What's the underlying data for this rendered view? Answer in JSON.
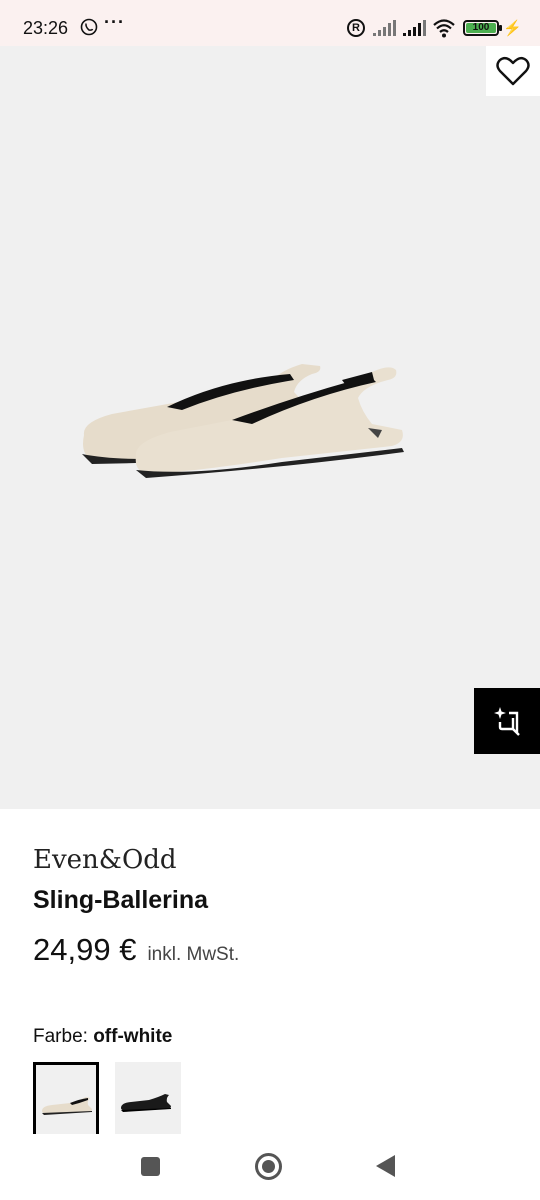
{
  "status_bar": {
    "time": "23:26",
    "more": "···",
    "roaming": "R",
    "battery": "100",
    "viber_icon": "viber-icon",
    "wifi_icon": "wifi-icon",
    "signal_icon": "signal-icon",
    "charging_icon": "charging-icon"
  },
  "product": {
    "brand": "Even&Odd",
    "name": "Sling-Ballerina",
    "price": "24,99 €",
    "tax_note": "inkl. MwSt.",
    "color_label": "Farbe:",
    "color_value": "off-white",
    "image": "product-image-shoes",
    "wishlist_icon": "heart-icon",
    "ai_icon": "sparkle-crop-icon"
  },
  "swatches": [
    {
      "color": "off-white",
      "selected": true
    },
    {
      "color": "black",
      "selected": false
    }
  ],
  "colors": {
    "hero_bg": "#f0f0f0",
    "status_bg": "#fbf1f0",
    "shoe": "#e6dccb",
    "accent": "#000000"
  },
  "nav_bar": {
    "recents_icon": "square-icon",
    "home_icon": "circle-home-icon",
    "back_icon": "triangle-back-icon"
  }
}
